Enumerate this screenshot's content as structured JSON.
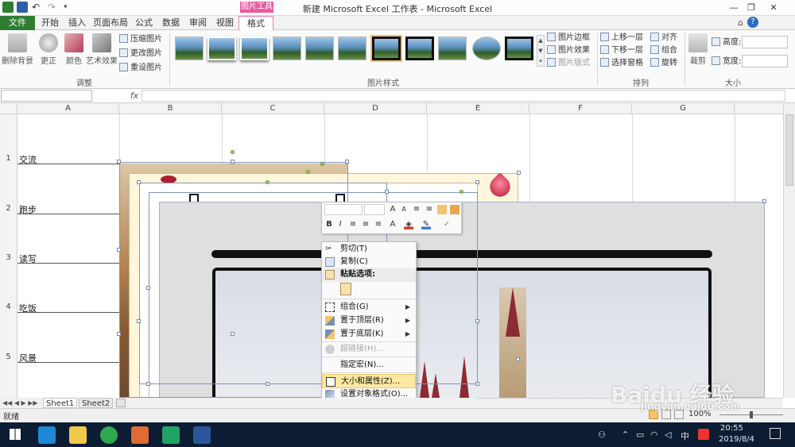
{
  "window": {
    "title": "新建 Microsoft Excel 工作表 - Microsoft Excel",
    "contextual_badge": "图片工具"
  },
  "tabs": [
    "文件",
    "开始",
    "插入",
    "页面布局",
    "公式",
    "数据",
    "审阅",
    "视图",
    "格式"
  ],
  "ribbon": {
    "adjust": {
      "buttons": [
        "删除背景",
        "更正",
        "颜色",
        "艺术效果"
      ],
      "small": [
        "压缩图片",
        "更改图片",
        "重设图片"
      ],
      "label": "调整"
    },
    "styles_label": "图片样式",
    "style_menu": [
      "图片边框",
      "图片效果",
      "图片版式"
    ],
    "arrange": {
      "col1": [
        "上移一层",
        "下移一层",
        "选择窗格"
      ],
      "col2": [
        "对齐",
        "组合",
        "旋转"
      ],
      "label": "排列"
    },
    "size": {
      "crop": "裁剪",
      "height_label": "高度:",
      "width_label": "宽度:",
      "label": "大小"
    }
  },
  "formula_bar": {
    "fx": "fx",
    "name_box": "",
    "value": ""
  },
  "columns": [
    "A",
    "B",
    "C",
    "D",
    "E",
    "F",
    "G"
  ],
  "rows": [
    {
      "num": "1",
      "label": "交流"
    },
    {
      "num": "2",
      "label": "跑步"
    },
    {
      "num": "3",
      "label": "读写"
    },
    {
      "num": "4",
      "label": "吃饭"
    },
    {
      "num": "5",
      "label": "风景"
    }
  ],
  "context_menu": {
    "items": [
      {
        "label": "剪切(T)",
        "icon": "scissors-icon",
        "enabled": true
      },
      {
        "label": "复制(C)",
        "icon": "copy-icon",
        "enabled": true
      },
      {
        "label": "粘贴选项:",
        "icon": "paste-icon",
        "enabled": true,
        "header": true
      },
      {
        "label": "组合(G)",
        "icon": "group-icon",
        "enabled": true,
        "submenu": true
      },
      {
        "label": "置于顶层(R)",
        "icon": "bring-front-icon",
        "enabled": true,
        "submenu": true
      },
      {
        "label": "置于底层(K)",
        "icon": "send-back-icon",
        "enabled": true,
        "submenu": true
      },
      {
        "label": "超链接(H)...",
        "icon": "hyperlink-icon",
        "enabled": false
      },
      {
        "label": "指定宏(N)...",
        "icon": "",
        "enabled": true
      },
      {
        "label": "大小和属性(Z)...",
        "icon": "size-props-icon",
        "enabled": true,
        "highlighted": true
      },
      {
        "label": "设置对象格式(O)...",
        "icon": "format-object-icon",
        "enabled": true
      }
    ]
  },
  "mini_toolbar": {
    "font_bold": "B",
    "font_italic": "I",
    "font_color": "A"
  },
  "sheets": [
    "Sheet1",
    "Sheet2"
  ],
  "status": {
    "ready": "就绪",
    "zoom": "100%"
  },
  "tray": {
    "time": "20:55",
    "date": "2019/8/4",
    "ime": "中"
  },
  "watermark": {
    "brand": "Baidu 经验",
    "url": "jingyan.baidu.com"
  },
  "colors": {
    "file_tab": "#2e7d32",
    "contextual": "#e95c9e",
    "taskbar": "#0b1c33",
    "menu_highlight": "#fde9a2"
  }
}
